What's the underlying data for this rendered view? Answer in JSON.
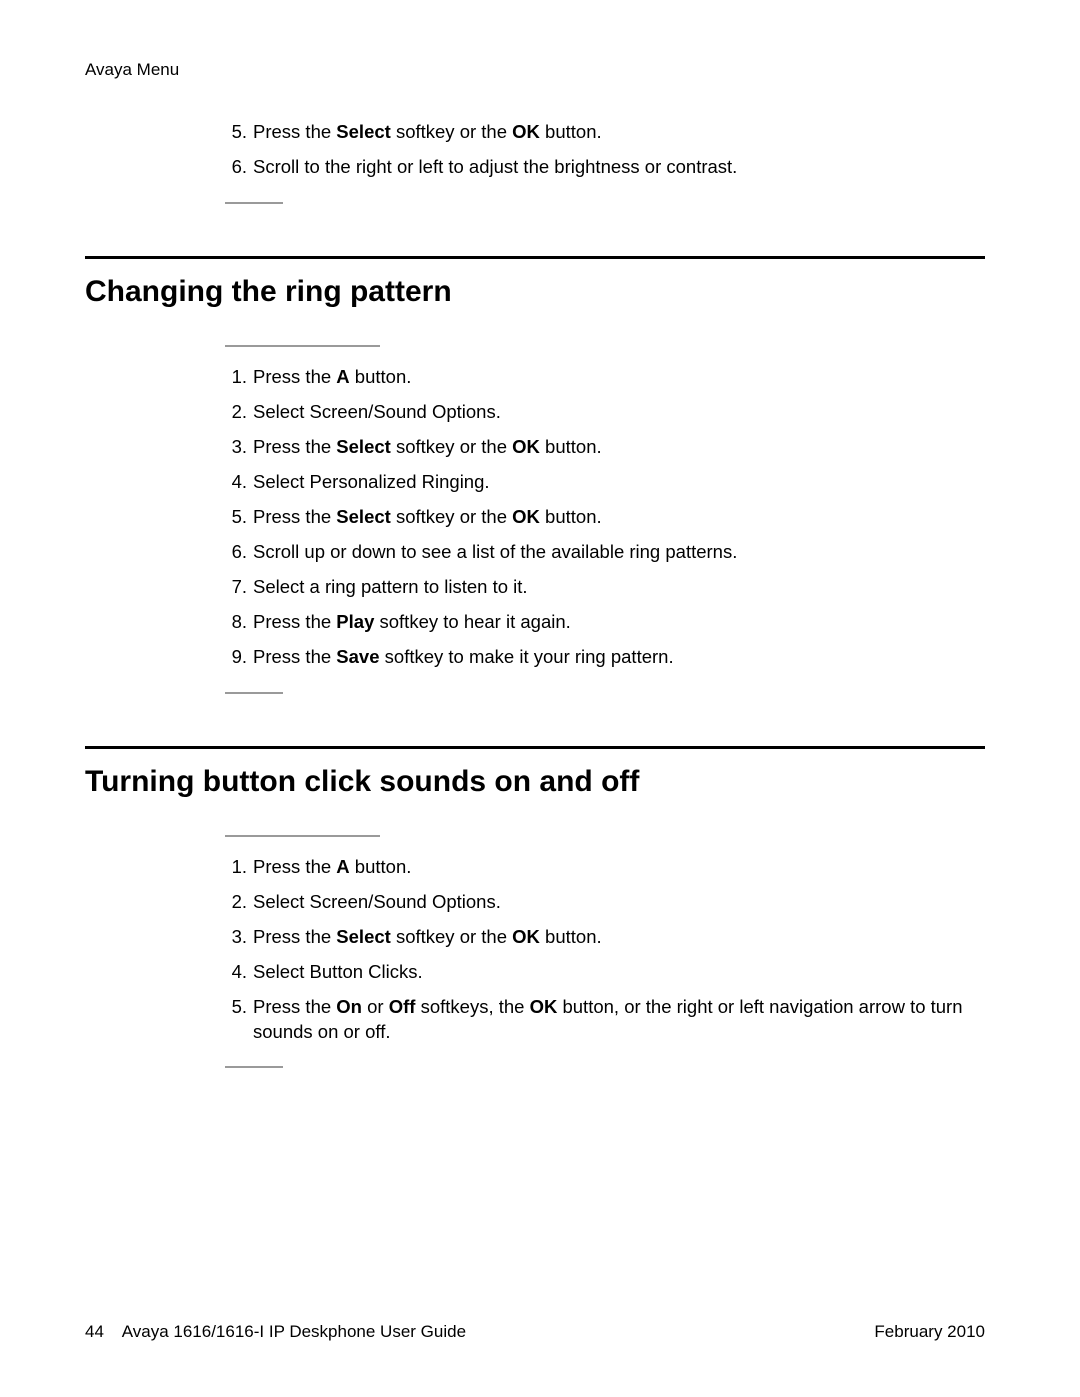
{
  "header": {
    "breadcrumb": "Avaya Menu"
  },
  "top_steps": {
    "start": 5,
    "items": [
      [
        {
          "t": "Press the "
        },
        {
          "t": "Select",
          "b": true
        },
        {
          "t": " softkey or the "
        },
        {
          "t": "OK",
          "b": true
        },
        {
          "t": " button."
        }
      ],
      [
        {
          "t": "Scroll to the right or left to adjust the brightness or contrast."
        }
      ]
    ]
  },
  "section1": {
    "title": "Changing the ring pattern",
    "start": 1,
    "items": [
      [
        {
          "t": "Press the "
        },
        {
          "t": "A",
          "b": true
        },
        {
          "t": " button."
        }
      ],
      [
        {
          "t": "Select Screen/Sound Options."
        }
      ],
      [
        {
          "t": "Press the "
        },
        {
          "t": "Select",
          "b": true
        },
        {
          "t": " softkey or the "
        },
        {
          "t": "OK",
          "b": true
        },
        {
          "t": " button."
        }
      ],
      [
        {
          "t": "Select Personalized Ringing."
        }
      ],
      [
        {
          "t": "Press the "
        },
        {
          "t": "Select",
          "b": true
        },
        {
          "t": " softkey or the "
        },
        {
          "t": "OK",
          "b": true
        },
        {
          "t": " button."
        }
      ],
      [
        {
          "t": "Scroll up or down to see a list of the available ring patterns."
        }
      ],
      [
        {
          "t": "Select a ring pattern to listen to it."
        }
      ],
      [
        {
          "t": "Press the "
        },
        {
          "t": "Play",
          "b": true
        },
        {
          "t": " softkey to hear it again."
        }
      ],
      [
        {
          "t": "Press the "
        },
        {
          "t": "Save",
          "b": true
        },
        {
          "t": " softkey to make it your ring pattern."
        }
      ]
    ]
  },
  "section2": {
    "title": "Turning button click sounds on and off",
    "start": 1,
    "items": [
      [
        {
          "t": "Press the "
        },
        {
          "t": "A",
          "b": true
        },
        {
          "t": " button."
        }
      ],
      [
        {
          "t": "Select Screen/Sound Options."
        }
      ],
      [
        {
          "t": "Press the "
        },
        {
          "t": "Select",
          "b": true
        },
        {
          "t": " softkey or the "
        },
        {
          "t": "OK",
          "b": true
        },
        {
          "t": " button."
        }
      ],
      [
        {
          "t": "Select Button Clicks."
        }
      ],
      [
        {
          "t": "Press the "
        },
        {
          "t": "On",
          "b": true
        },
        {
          "t": " or "
        },
        {
          "t": "Off",
          "b": true
        },
        {
          "t": " softkeys, the "
        },
        {
          "t": "OK",
          "b": true
        },
        {
          "t": " button, or the right or left navigation arrow to turn sounds on or off."
        }
      ]
    ]
  },
  "footer": {
    "page": "44",
    "guide": "Avaya 1616/1616-I IP Deskphone User Guide",
    "date": "February 2010"
  }
}
